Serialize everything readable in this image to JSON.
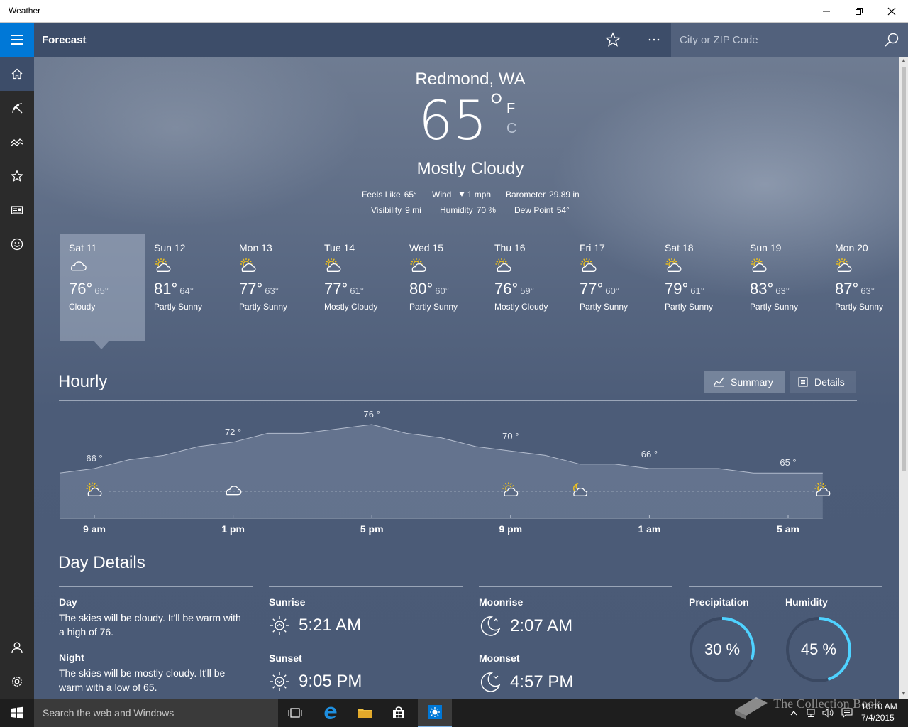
{
  "window": {
    "title": "Weather"
  },
  "header": {
    "page_title": "Forecast",
    "search_placeholder": "City or ZIP Code"
  },
  "current": {
    "location": "Redmond, WA",
    "temp": "65",
    "degree": "°",
    "unit_f": "F",
    "unit_c": "C",
    "condition": "Mostly Cloudy",
    "feels_like_label": "Feels Like",
    "feels_like": "65°",
    "wind_label": "Wind",
    "wind": "1 mph",
    "barometer_label": "Barometer",
    "barometer": "29.89 in",
    "visibility_label": "Visibility",
    "visibility": "9 mi",
    "humidity_label": "Humidity",
    "humidity": "70 %",
    "dew_point_label": "Dew Point",
    "dew_point": "54°"
  },
  "daily": [
    {
      "day": "Sat 11",
      "hi": "76°",
      "lo": "65°",
      "cond": "Cloudy",
      "icon": "cloudy-icon"
    },
    {
      "day": "Sun 12",
      "hi": "81°",
      "lo": "64°",
      "cond": "Partly Sunny",
      "icon": "partly-sunny-icon"
    },
    {
      "day": "Mon 13",
      "hi": "77°",
      "lo": "63°",
      "cond": "Partly Sunny",
      "icon": "partly-sunny-icon"
    },
    {
      "day": "Tue 14",
      "hi": "77°",
      "lo": "61°",
      "cond": "Mostly Cloudy",
      "icon": "partly-sunny-icon"
    },
    {
      "day": "Wed 15",
      "hi": "80°",
      "lo": "60°",
      "cond": "Partly Sunny",
      "icon": "partly-sunny-icon"
    },
    {
      "day": "Thu 16",
      "hi": "76°",
      "lo": "59°",
      "cond": "Mostly Cloudy",
      "icon": "partly-sunny-icon"
    },
    {
      "day": "Fri 17",
      "hi": "77°",
      "lo": "60°",
      "cond": "Partly Sunny",
      "icon": "partly-sunny-icon"
    },
    {
      "day": "Sat 18",
      "hi": "79°",
      "lo": "61°",
      "cond": "Partly Sunny",
      "icon": "partly-sunny-icon"
    },
    {
      "day": "Sun 19",
      "hi": "83°",
      "lo": "63°",
      "cond": "Partly Sunny",
      "icon": "partly-sunny-icon"
    },
    {
      "day": "Mon 20",
      "hi": "87°",
      "lo": "63°",
      "cond": "Partly Sunny",
      "icon": "partly-sunny-icon"
    }
  ],
  "hourly": {
    "title": "Hourly",
    "summary_label": "Summary",
    "details_label": "Details",
    "time_labels": [
      "9 am",
      "1 pm",
      "5 pm",
      "9 pm",
      "1 am",
      "5 am"
    ],
    "temp_labels": [
      {
        "text": "66 °",
        "hour": 0
      },
      {
        "text": "72 °",
        "hour": 4
      },
      {
        "text": "76 °",
        "hour": 8
      },
      {
        "text": "70 °",
        "hour": 12
      },
      {
        "text": "66 °",
        "hour": 16
      },
      {
        "text": "65 °",
        "hour": 20
      }
    ],
    "series": [
      65,
      66,
      68,
      69,
      71,
      72,
      74,
      74,
      75,
      76,
      74,
      73,
      71,
      70,
      69,
      67,
      67,
      66,
      66,
      66,
      65,
      65,
      65
    ],
    "icons": [
      {
        "name": "partly-sunny-icon",
        "hour": 0
      },
      {
        "name": "cloudy-icon",
        "hour": 4
      },
      {
        "name": "partly-sunny-icon",
        "hour": 12
      },
      {
        "name": "partly-cloudy-night-icon",
        "hour": 14
      },
      {
        "name": "partly-sunny-icon",
        "hour": 21
      }
    ]
  },
  "day_details": {
    "title": "Day Details",
    "day_label": "Day",
    "day_text": "The skies will be cloudy. It'll be warm with a high of 76.",
    "night_label": "Night",
    "night_text": "The skies will be mostly cloudy. It'll be warm with a low of 65.",
    "sunrise_label": "Sunrise",
    "sunrise": "5:21 AM",
    "sunset_label": "Sunset",
    "sunset": "9:05 PM",
    "moonrise_label": "Moonrise",
    "moonrise": "2:07 AM",
    "moonset_label": "Moonset",
    "moonset": "4:57 PM",
    "precipitation_label": "Precipitation",
    "precipitation": "30 %",
    "precipitation_value": 0.3,
    "humidity_label": "Humidity",
    "humidity": "45 %",
    "humidity_value": 0.45,
    "accent": "#4fd2ff"
  },
  "taskbar": {
    "search_placeholder": "Search the web and Windows",
    "time": "10:10 AM",
    "date": "7/4/2015"
  },
  "watermark": "The Collection Book"
}
